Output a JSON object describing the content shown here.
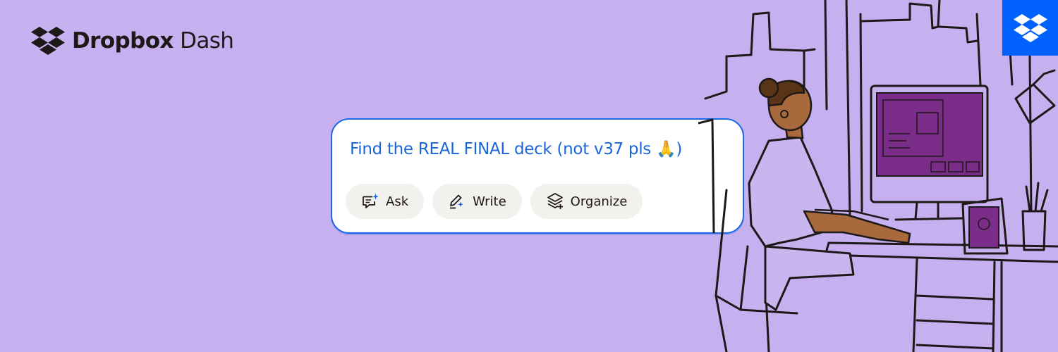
{
  "brand": {
    "name_bold": "Dropbox",
    "name_light": "Dash",
    "logo_icon": "dropbox-logo-icon",
    "badge_icon": "dropbox-logo-icon",
    "badge_color": "#0061fe"
  },
  "search": {
    "query": "Find the REAL FINAL deck (not v37 pls 🙏)",
    "text_color": "#1a66d8",
    "border_color": "#1b67e6"
  },
  "actions": [
    {
      "label": "Ask",
      "icon": "ask-chat-sparkle-icon"
    },
    {
      "label": "Write",
      "icon": "write-pen-sparkle-icon"
    },
    {
      "label": "Organize",
      "icon": "organize-layers-icon"
    }
  ],
  "colors": {
    "background": "#c6b0ef",
    "screen_purple": "#7a2e8a",
    "skin": "#a86a3d"
  }
}
